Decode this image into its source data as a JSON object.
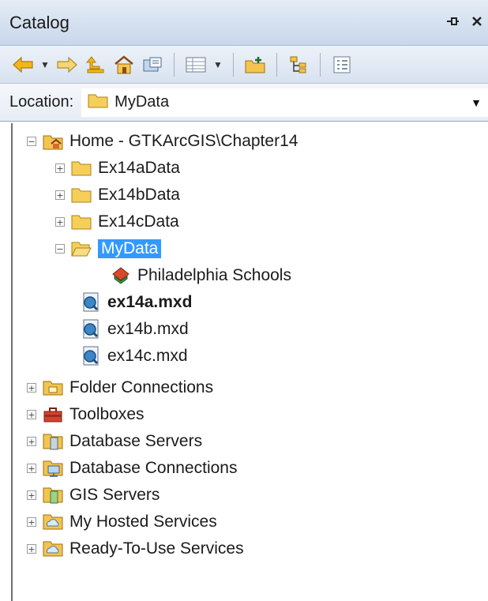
{
  "window": {
    "title": "Catalog",
    "pin_glyph": "⊕",
    "close_glyph": "✕"
  },
  "toolbar": {
    "icons": [
      "back-arrow-icon",
      "dropdown-arrow",
      "forward-arrow-icon",
      "up-level-icon",
      "home-folder-icon",
      "toggle-contents-icon",
      "view-options-icon",
      "dropdown-arrow",
      "connect-folder-icon",
      "tree-view-icon",
      "options-icon"
    ]
  },
  "location": {
    "label": "Location:",
    "value": "MyData"
  },
  "tree": {
    "home": "Home - GTKArcGIS\\Chapter14",
    "folders": [
      "Ex14aData",
      "Ex14bData",
      "Ex14cData"
    ],
    "selected_folder": "MyData",
    "dataset": "Philadelphia Schools",
    "mxd_files": [
      "ex14a.mxd",
      "ex14b.mxd",
      "ex14c.mxd"
    ],
    "top_items": [
      "Folder Connections",
      "Toolboxes",
      "Database Servers",
      "Database Connections",
      "GIS Servers",
      "My Hosted Services",
      "Ready-To-Use Services"
    ],
    "expand_plus": "+",
    "expand_minus": "−"
  }
}
